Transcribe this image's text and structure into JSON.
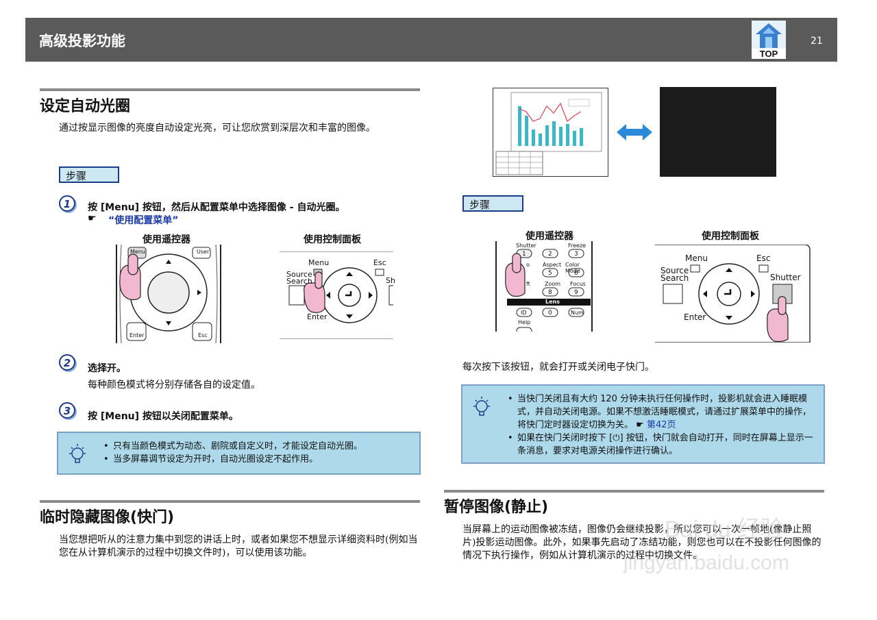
{
  "header": {
    "title": "高级投影功能",
    "top_label": "TOP",
    "page_number": "21"
  },
  "section_auto_iris": {
    "title": "设定自动光圈",
    "intro": "通过按显示图像的亮度自动设定光亮，可让您欣赏到深层次和丰富的图像。",
    "steps_label": "步骤",
    "step1": {
      "num": "1",
      "text": "按 [Menu] 按钮，然后从配置菜单中选择图像 - 自动光圈。",
      "link": "“使用配置菜单”"
    },
    "remote_label": "使用遥控器",
    "panel_label": "使用控制面板",
    "remote_keys": {
      "menu": "Menu",
      "user": "User",
      "enter": "Enter",
      "esc": "Esc"
    },
    "panel_keys": {
      "menu": "Menu",
      "esc": "Esc",
      "source": "Source",
      "search": "Search",
      "enter": "Enter",
      "sh": "Sh"
    },
    "step2": {
      "num": "2",
      "text": "选择开。",
      "desc": "每种颜色模式将分别存储各自的设定值。"
    },
    "step3": {
      "num": "3",
      "text": "按 [Menu] 按钮以关闭配置菜单。"
    },
    "note": [
      "只有当颜色模式为动态、剧院或自定义时，才能设定自动光圈。",
      "当多屏幕调节设定为开时，自动光圈设定不起作用。"
    ]
  },
  "section_shutter": {
    "title": "临时隐藏图像(快门)",
    "intro": "当您想把听从的注意力集中到您的讲话上时，或者如果您不想显示详细资料时(例如当您在从计算机演示的过程中切换文件时)，可以使用该功能。"
  },
  "right_col": {
    "steps_label": "步骤",
    "remote_label": "使用遥控器",
    "panel_label": "使用控制面板",
    "remote_keys": {
      "shutter": "Shutter",
      "freeze": "Freeze",
      "aspect": "Aspect",
      "color_mode": "Color Mode",
      "zoom": "Zoom",
      "focus": "Focus",
      "lens": "Lens",
      "id": "ID",
      "num": "Num",
      "help": "Help",
      "k1": "1",
      "k2": "2",
      "k3": "3",
      "k5": "5",
      "k6": "6",
      "k8": "8",
      "k9": "9",
      "k0": "0",
      "frag_o": "o",
      "frag_ft": "ft"
    },
    "panel_keys": {
      "menu": "Menu",
      "esc": "Esc",
      "source": "Source",
      "search": "Search",
      "enter": "Enter",
      "shutter": "Shutter"
    },
    "desc": "每次按下该按钮，就会打开或关闭电子快门。",
    "note": [
      "当快门关闭且有大约 120 分钟未执行任何操作时，投影机就会进入睡眠模式，并自动关闭电源。如果不想激活睡眠模式，请通过扩展菜单中的操作，将快门定时器设定切换为关。",
      "如果在快门关闭时按下 [⏻] 按钮，快门就会自动打开，同时在屏幕上显示一条消息，要求对电源关闭操作进行确认。"
    ],
    "note_link": "第42页"
  },
  "section_freeze": {
    "title": "暂停图像(静止)",
    "intro": "当屏幕上的运动图像被冻结，图像仍会继续投影，所以您可以一次一帧地(像静止照片)投影运动图像。此外，如果事先启动了冻结功能，则您也可以在不投影任何图像的情况下执行操作，例如从计算机演示的过程中切换文件。"
  },
  "watermark": {
    "line1": "Bai du 经验",
    "line2": "jingyan.baidu.com"
  },
  "colors": {
    "header_bg": "#5a5a5a",
    "note_bg": "#add9ea",
    "step_box_bg": "#cde8f3",
    "accent_blue": "#1a3a8a",
    "arrow_blue": "#2a8ad8"
  }
}
